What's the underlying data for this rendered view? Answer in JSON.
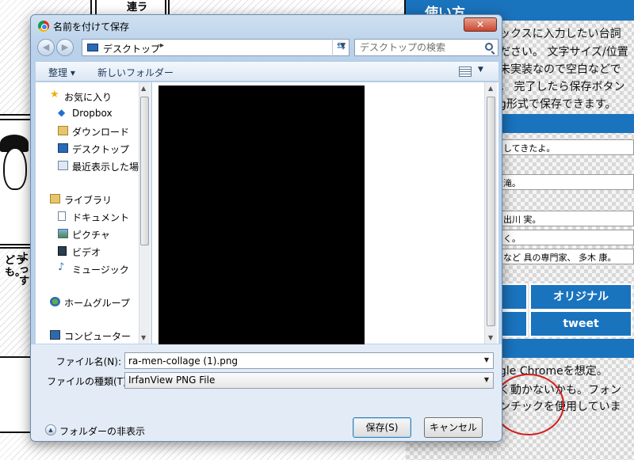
{
  "background": {
    "manga": {
      "balloon_1": "連ラ",
      "balloon_2": "よ\nっ\nす",
      "balloon_3": "どう\nも。"
    },
    "right_page": {
      "header": "使い方",
      "instructions": [
        "ックスに入力したい台詞",
        "ださい。 文字サイズ/位置",
        "未実装なので空白などで",
        "。 完了したら保存ボタン",
        "g形式で保存できます。"
      ],
      "inputs": [
        "してきたよ。",
        "滝。",
        "出川 実。",
        "く。",
        "など 具の専門家、 多木 康。"
      ],
      "buttons": {
        "original": "オリジナル",
        "tweet": "tweet"
      },
      "notes": [
        "gle Chromeを想定。",
        "く動かないかも。フォン",
        "ンチックを使用していま"
      ],
      "highlight_word": "ンチック"
    }
  },
  "dialog": {
    "title": "名前を付けて保存",
    "close_label": "✕",
    "address": {
      "location": "デスクトップ",
      "separator": "▸"
    },
    "search_placeholder": "デスクトップの検索",
    "toolbar": {
      "organize": "整理 ▾",
      "new_folder": "新しいフォルダー"
    },
    "nav": {
      "favorites": "お気に入り",
      "dropbox": "Dropbox",
      "downloads": "ダウンロード",
      "desktop": "デスクトップ",
      "recent": "最近表示した場所",
      "libraries": "ライブラリ",
      "documents": "ドキュメント",
      "pictures": "ピクチャ",
      "videos": "ビデオ",
      "music": "ミュージック",
      "homegroup": "ホームグループ",
      "computer": "コンピューター"
    },
    "filename_label": "ファイル名(N):",
    "filename_value": "ra-men-collage (1).png",
    "filetype_label": "ファイルの種類(T):",
    "filetype_value": "IrfanView PNG File",
    "hide_folders": "フォルダーの非表示",
    "save_button": "保存(S)",
    "cancel_button": "キャンセル",
    "colors": {
      "accent": "#1a73bd",
      "highlight_circle": "#d32020"
    }
  }
}
